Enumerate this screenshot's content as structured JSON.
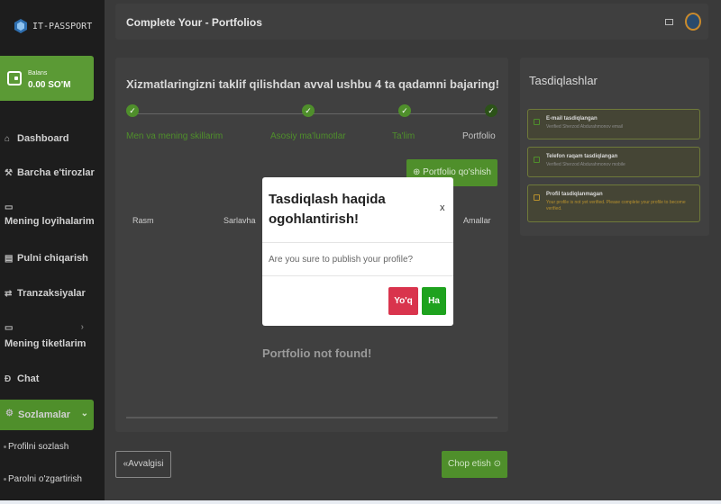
{
  "sidebar": {
    "logo_text": "IT-PASSPORT",
    "balance": {
      "label": "Balans",
      "value": "0.00 SO'M"
    },
    "items": [
      {
        "label": "Dashboard",
        "icon": "home-icon"
      },
      {
        "label": "Barcha e'tirozlar",
        "icon": "hammer-icon"
      },
      {
        "label": "Mening loyihalarim",
        "icon": "briefcase-icon"
      },
      {
        "label": "Pulni chiqarish",
        "icon": "card-icon"
      },
      {
        "label": "Tranzaksiyalar",
        "icon": "transfer-icon"
      },
      {
        "label": "Mening tiketlarim",
        "icon": "ticket-icon"
      },
      {
        "label": "Chat",
        "icon": "chat-icon"
      },
      {
        "label": "Sozlamalar",
        "icon": "gear-icon"
      }
    ],
    "sub_items": [
      {
        "label": "Profilni sozlash"
      },
      {
        "label": "Parolni o'zgartirish"
      }
    ]
  },
  "header": {
    "title": "Complete Your - Portfolios"
  },
  "main": {
    "heading": "Xizmatlaringizni taklif qilishdan avval ushbu 4 ta qadamni bajaring!",
    "steps": [
      {
        "label": "Men va mening skillarim"
      },
      {
        "label": "Asosiy ma'lumotlar"
      },
      {
        "label": "Ta'lim"
      },
      {
        "label": "Portfolio"
      }
    ],
    "add_button": "Portfolio qo'shish",
    "table_headers": [
      "Rasm",
      "Sarlavha",
      "Amallar"
    ],
    "empty_message": "Portfolio not found!",
    "prev_button": "Avvalgisi",
    "print_button": "Chop etish"
  },
  "side": {
    "title": "Tasdiqlashlar",
    "items": [
      {
        "title": "E-mail tasdiqlangan",
        "subtitle": "Verified Sherzod Abdurahmonov email"
      },
      {
        "title": "Telefon raqam tasdiqlangan",
        "subtitle": "Verified Sherzod Abdurahmonov mobile"
      },
      {
        "title": "Profil tasdiqlanmagan",
        "subtitle": "Your profile is not yet verified. Please complete your profile to become verified."
      }
    ]
  },
  "modal": {
    "title": "Tasdiqlash haqida ogohlantirish!",
    "close": "x",
    "message": "Are you sure to publish your profile?",
    "no_button": "Yo'q",
    "yes_button": "Ha"
  },
  "colors": {
    "accent": "#4f8f2b",
    "danger": "#d9344d",
    "success": "#1ea21e"
  }
}
